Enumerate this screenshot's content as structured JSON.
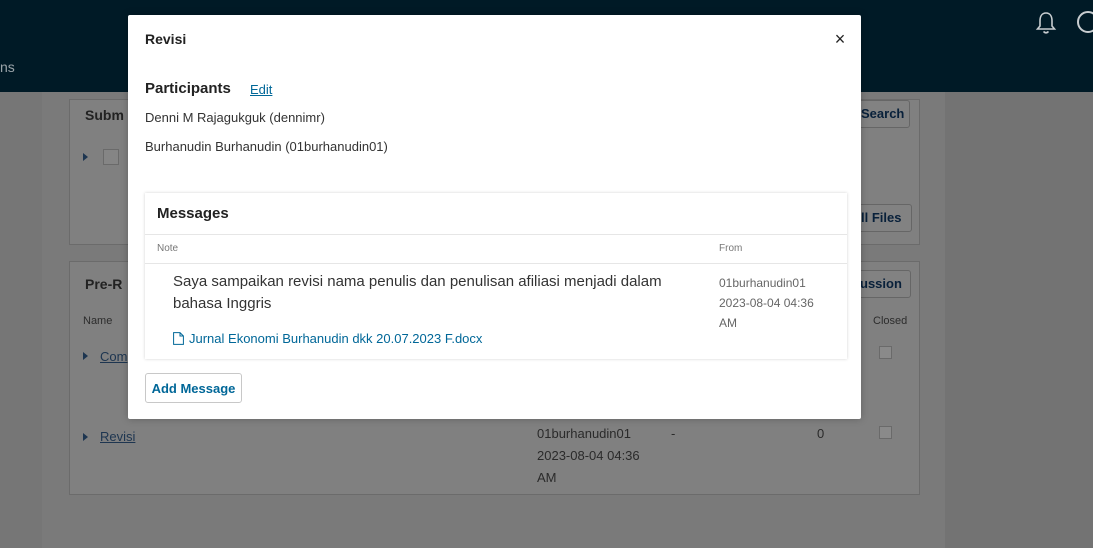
{
  "background": {
    "nav_fragment": "ns",
    "submission_panel_title": "Subm",
    "search_button": "Search",
    "all_files_button": "ll Files",
    "prereview_panel_title": "Pre-R",
    "discussion_button": "ussion",
    "col_name": "Name",
    "col_closed": "Closed",
    "row1_link": "Com",
    "row2_link": "Revisi",
    "row2_from_user": "01burhanudin01",
    "row2_from_dash": "-",
    "row2_from_date": "2023-08-04 04:36",
    "row2_from_ampm": "AM",
    "row2_count": "0"
  },
  "modal": {
    "title": "Revisi",
    "close_label": "×",
    "participants_heading": "Participants",
    "edit_label": "Edit",
    "participants": [
      "Denni M Rajagukguk (dennimr)",
      "Burhanudin Burhanudin (01burhanudin01)"
    ],
    "messages": {
      "heading": "Messages",
      "col_note": "Note",
      "col_from": "From",
      "items": [
        {
          "note": "Saya sampaikan revisi nama penulis dan penulisan afiliasi menjadi dalam bahasa Inggris",
          "attachment": "Jurnal Ekonomi Burhanudin dkk 20.07.2023 F.docx",
          "from_user": "01burhanudin01",
          "from_date": "2023-08-04 04:36",
          "from_ampm": "AM"
        }
      ]
    },
    "add_message_label": "Add Message"
  }
}
